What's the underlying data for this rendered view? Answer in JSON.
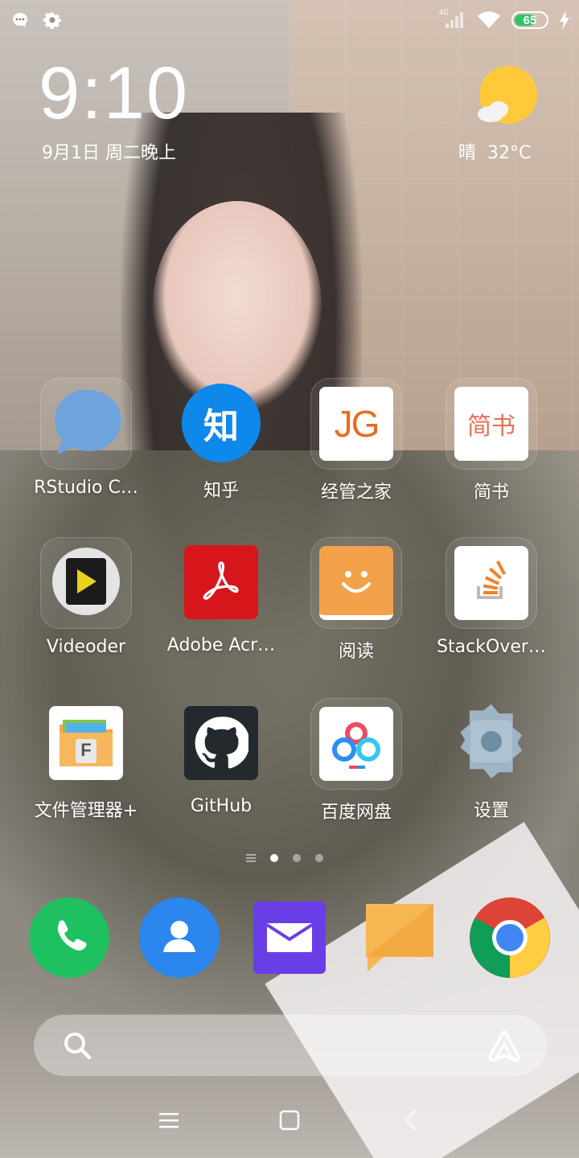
{
  "status_bar": {
    "left_icons": [
      "notification-bubble-icon",
      "gear-icon"
    ],
    "right_icons": [
      "signal-icon",
      "wifi-icon",
      "battery-icon",
      "charging-icon"
    ],
    "network_label": "4G",
    "battery_level": 65,
    "battery_text": "65"
  },
  "clock": {
    "time": "9:10",
    "date": "9月1日 周二晚上"
  },
  "weather": {
    "condition": "晴",
    "temperature": "32°C",
    "icon": "sunny-cloud-icon"
  },
  "apps": [
    {
      "label": "RStudio C…",
      "icon": "chat-bubble-icon",
      "color": "#6fa3dc"
    },
    {
      "label": "知乎",
      "icon": "zhihu-icon",
      "glyph": "知",
      "color": "#0f88eb"
    },
    {
      "label": "经管之家",
      "icon": "jg-icon",
      "glyph": "JG",
      "color": "#e86d21"
    },
    {
      "label": "简书",
      "icon": "jianshu-icon",
      "glyph": "简书",
      "color": "#ea6f5a"
    },
    {
      "label": "Videoder",
      "icon": "videoder-icon",
      "color": "#e9d21a"
    },
    {
      "label": "Adobe Acr…",
      "icon": "adobe-acrobat-icon",
      "color": "#d7161b"
    },
    {
      "label": "阅读",
      "icon": "reader-icon",
      "color": "#f3a14b"
    },
    {
      "label": "StackOver…",
      "icon": "stackoverflow-icon",
      "color": "#f48024"
    },
    {
      "label": "文件管理器+",
      "icon": "file-manager-icon",
      "glyph": "F",
      "color": "#f3a74a"
    },
    {
      "label": "GitHub",
      "icon": "github-icon",
      "color": "#24292e"
    },
    {
      "label": "百度网盘",
      "icon": "baidu-netdisk-icon",
      "color": "#2c8ef8"
    },
    {
      "label": "设置",
      "icon": "settings-gear-icon",
      "color": "#9fb5c6"
    }
  ],
  "page_indicator": {
    "pages": 3,
    "current": 1
  },
  "dock": [
    {
      "name": "phone",
      "icon": "phone-icon",
      "color": "#1fc060"
    },
    {
      "name": "contacts",
      "icon": "contacts-icon",
      "color": "#2b86ee"
    },
    {
      "name": "email",
      "icon": "email-icon",
      "color": "#6a3ee6"
    },
    {
      "name": "messages",
      "icon": "message-icon",
      "color": "#f6b752"
    },
    {
      "name": "chrome",
      "icon": "chrome-icon",
      "color": "#4285f4"
    }
  ],
  "search": {
    "icon": "search-icon",
    "assistant_icon": "assistant-icon"
  },
  "nav_bar": [
    "menu-icon",
    "home-icon",
    "back-icon"
  ]
}
